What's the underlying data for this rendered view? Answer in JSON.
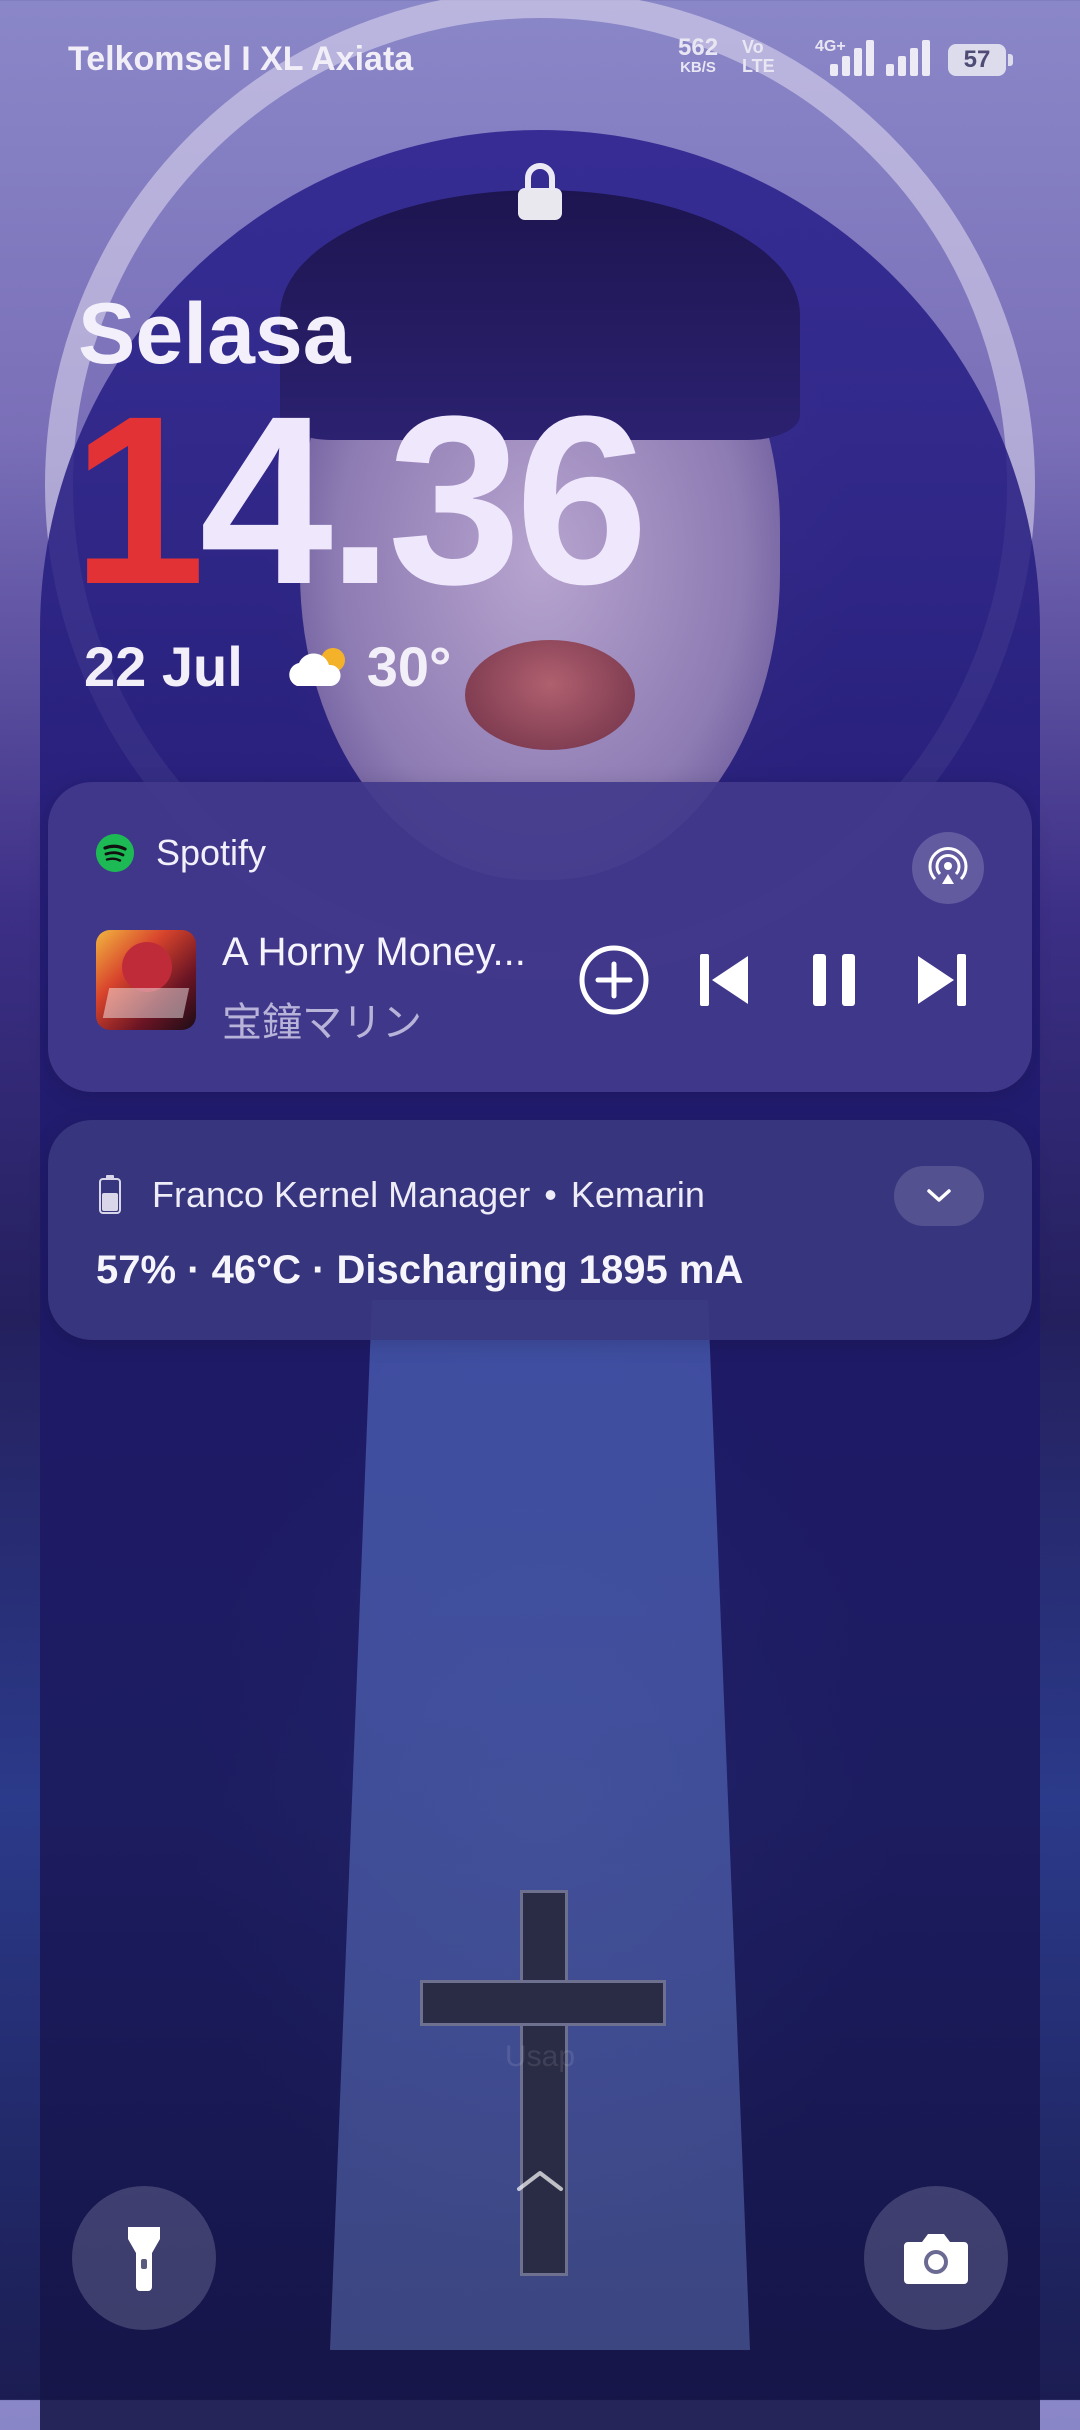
{
  "status_bar": {
    "carrier": "Telkomsel I XL Axiata",
    "net_speed_value": "562",
    "net_speed_unit": "KB/S",
    "volte_top": "Vo",
    "volte_bottom": "LTE",
    "network_type": "4G+",
    "battery_level": "57"
  },
  "lock_screen": {
    "day": "Selasa",
    "time_first": "1",
    "time_rest": "4.36",
    "date": "22 Jul",
    "temperature": "30°",
    "weather_icon": "partly-cloudy-icon",
    "unlock_hint": "Usap"
  },
  "media_card": {
    "app_name": "Spotify",
    "track_title": "A Horny Money...",
    "artist": "宝鐘マリン",
    "playing": true
  },
  "notification": {
    "app_name": "Franco Kernel Manager",
    "separator": "•",
    "time": "Kemarin",
    "body": "57% · 46°C · Discharging 1895 mA"
  },
  "colors": {
    "accent_red": "#e23236",
    "card_bg": "#423a8c",
    "spotify_green": "#1DB954"
  }
}
